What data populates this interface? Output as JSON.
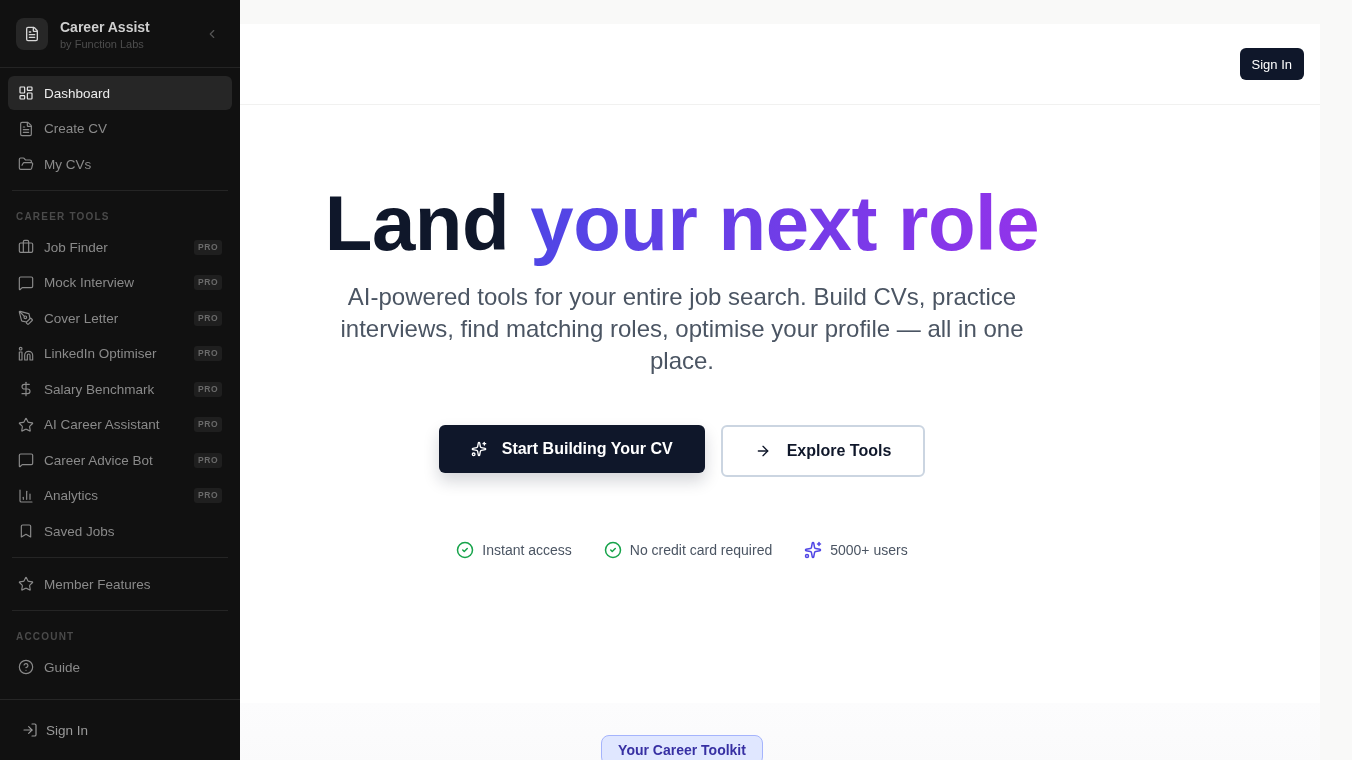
{
  "sidebar": {
    "title": "Career Assist",
    "subtitle": "by Function Labs",
    "groups": [
      {
        "items": [
          {
            "label": "Dashboard",
            "selected": true
          },
          {
            "label": "Create CV",
            "selected": false
          },
          {
            "label": "My CVs",
            "selected": false
          }
        ]
      },
      {
        "heading": "CAREER TOOLS",
        "items": [
          {
            "label": "Job Finder",
            "selected": false,
            "badge": "PRO"
          },
          {
            "label": "Mock Interview",
            "selected": false,
            "badge": "PRO"
          },
          {
            "label": "Cover Letter",
            "selected": false,
            "badge": "PRO"
          },
          {
            "label": "LinkedIn Optimiser",
            "selected": false,
            "badge": "PRO"
          },
          {
            "label": "Salary Benchmark",
            "selected": false,
            "badge": "PRO"
          },
          {
            "label": "AI Career Assistant",
            "selected": false,
            "badge": "PRO"
          },
          {
            "label": "Career Advice Bot",
            "selected": false,
            "badge": "PRO"
          },
          {
            "label": "Analytics",
            "selected": false,
            "badge": "PRO"
          },
          {
            "label": "Saved Jobs",
            "selected": false
          }
        ]
      },
      {
        "items": [
          {
            "label": "Member Features",
            "selected": false
          }
        ]
      },
      {
        "heading": "ACCOUNT",
        "items": [
          {
            "label": "Guide",
            "selected": false
          }
        ]
      }
    ],
    "footer_action": "Sign In"
  },
  "header": {
    "sign_in": "Sign In"
  },
  "hero": {
    "title_lead": "Land",
    "title_highlight": "your next role",
    "subtitle": "AI-powered tools for your entire job search. Build CVs, practice interviews, find matching roles, optimise your profile — all in one place.",
    "primary_action": "Start Building Your CV",
    "secondary_action": "Explore Tools",
    "highlights": [
      {
        "label": "Instant access",
        "kind": "check"
      },
      {
        "label": "No credit card required",
        "kind": "check"
      },
      {
        "label": "5000+ users",
        "kind": "sparkle"
      }
    ]
  },
  "toolkit": {
    "badge": "Your Career Toolkit"
  }
}
